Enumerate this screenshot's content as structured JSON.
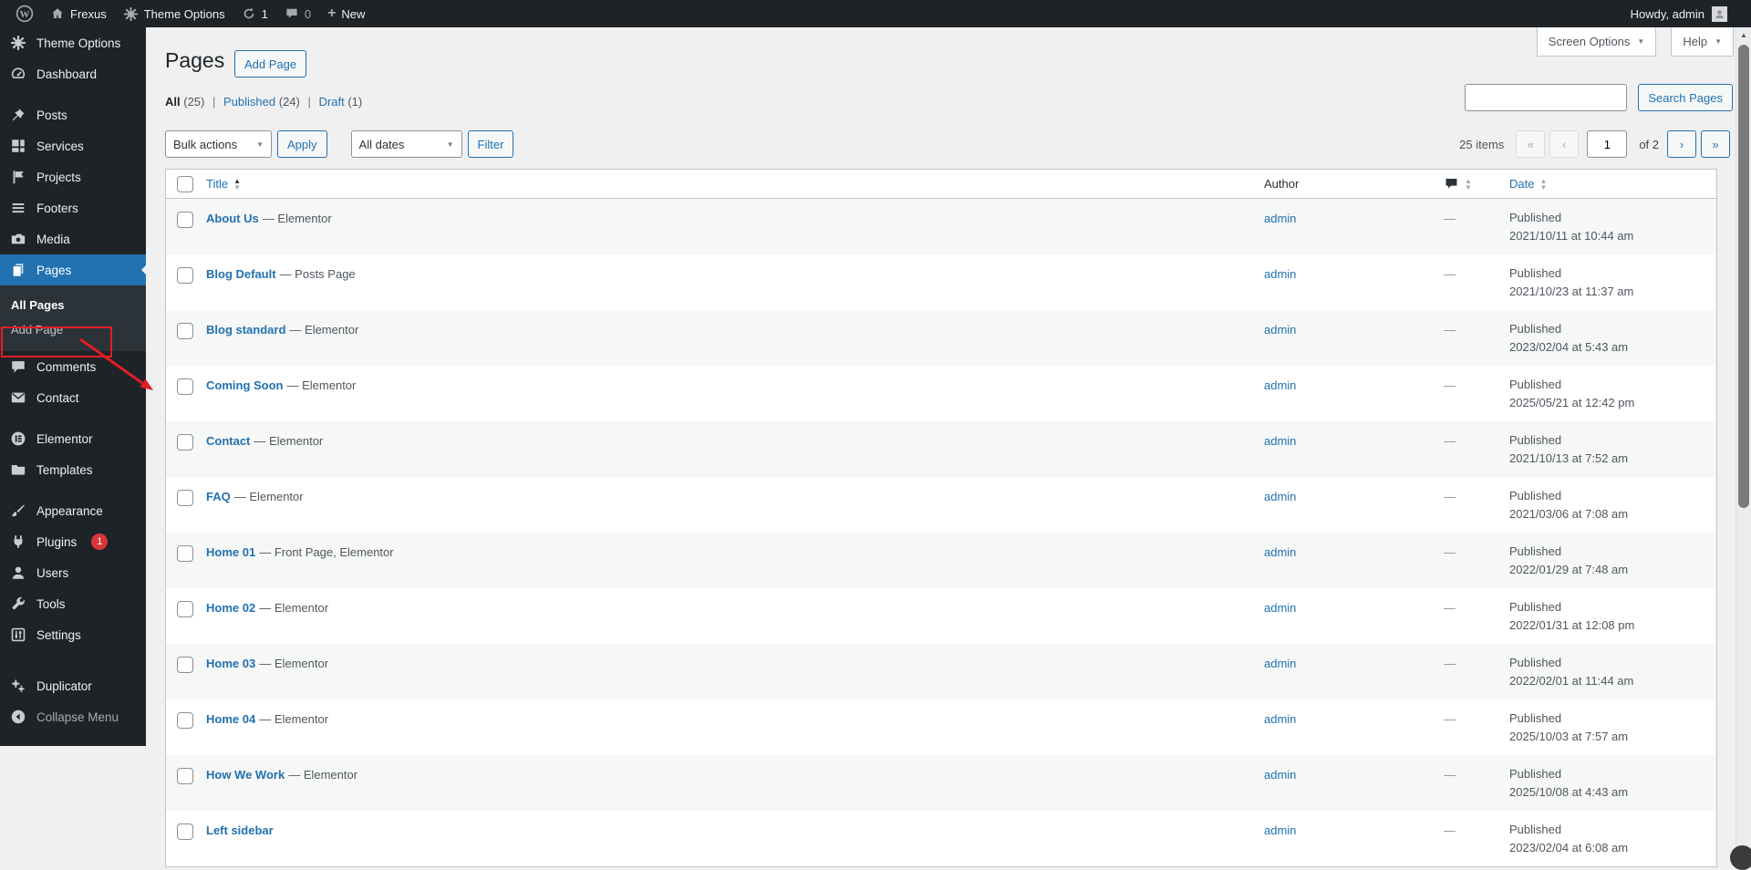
{
  "colors": {
    "accent": "#2271b1",
    "menu_dark": "#1d2327",
    "badge_red": "#d63638",
    "annotation_red": "#e11e26",
    "stripe": "#f6f7f7"
  },
  "admin_bar": {
    "site_name": "Frexus",
    "theme_options": "Theme Options",
    "update_count": "1",
    "comment_count": "0",
    "new_label": "New",
    "greeting": "Howdy, admin"
  },
  "sidebar": {
    "items": [
      {
        "label": "Theme Options"
      },
      {
        "label": "Dashboard"
      },
      {
        "label": "Posts"
      },
      {
        "label": "Services"
      },
      {
        "label": "Projects"
      },
      {
        "label": "Footers"
      },
      {
        "label": "Media"
      },
      {
        "label": "Pages",
        "active": true
      },
      {
        "label": "Comments"
      },
      {
        "label": "Contact"
      },
      {
        "label": "Elementor"
      },
      {
        "label": "Templates"
      },
      {
        "label": "Appearance"
      },
      {
        "label": "Plugins"
      },
      {
        "label": "Users"
      },
      {
        "label": "Tools"
      },
      {
        "label": "Settings"
      },
      {
        "label": "Duplicator"
      },
      {
        "label": "Collapse Menu"
      }
    ],
    "plugins_badge": "1",
    "submenu": {
      "all_pages": "All Pages",
      "add_page": "Add Page"
    }
  },
  "meta_tabs": {
    "screen_options": "Screen Options",
    "help": "Help"
  },
  "page": {
    "title": "Pages",
    "add_button": "Add Page"
  },
  "views": {
    "all": "All",
    "all_count": "(25)",
    "published": "Published",
    "published_count": "(24)",
    "draft": "Draft",
    "draft_count": "(1)",
    "separator": "|"
  },
  "toolbar": {
    "bulk_actions": "Bulk actions",
    "apply": "Apply",
    "all_dates": "All dates",
    "filter": "Filter"
  },
  "search": {
    "value": "",
    "button": "Search Pages"
  },
  "pagination": {
    "items": "25 items",
    "first": "«",
    "prev": "‹",
    "current_page": "1",
    "of": "of 2",
    "next": "›",
    "last": "»"
  },
  "table": {
    "columns": {
      "title": "Title",
      "author": "Author",
      "date": "Date"
    },
    "rows": [
      {
        "title": "About Us",
        "suffix": "— Elementor",
        "author": "admin",
        "comments": "—",
        "status": "Published",
        "date": "2021/10/11 at 10:44 am"
      },
      {
        "title": "Blog Default",
        "suffix": "— Posts Page",
        "author": "admin",
        "comments": "—",
        "status": "Published",
        "date": "2021/10/23 at 11:37 am"
      },
      {
        "title": "Blog standard",
        "suffix": "— Elementor",
        "author": "admin",
        "comments": "—",
        "status": "Published",
        "date": "2023/02/04 at 5:43 am"
      },
      {
        "title": "Coming Soon",
        "suffix": "— Elementor",
        "author": "admin",
        "comments": "—",
        "status": "Published",
        "date": "2025/05/21 at 12:42 pm"
      },
      {
        "title": "Contact",
        "suffix": "— Elementor",
        "author": "admin",
        "comments": "—",
        "status": "Published",
        "date": "2021/10/13 at 7:52 am"
      },
      {
        "title": "FAQ",
        "suffix": "— Elementor",
        "author": "admin",
        "comments": "—",
        "status": "Published",
        "date": "2021/03/06 at 7:08 am"
      },
      {
        "title": "Home 01",
        "suffix": "— Front Page, Elementor",
        "author": "admin",
        "comments": "—",
        "status": "Published",
        "date": "2022/01/29 at 7:48 am"
      },
      {
        "title": "Home 02",
        "suffix": "— Elementor",
        "author": "admin",
        "comments": "—",
        "status": "Published",
        "date": "2022/01/31 at 12:08 pm"
      },
      {
        "title": "Home 03",
        "suffix": "— Elementor",
        "author": "admin",
        "comments": "—",
        "status": "Published",
        "date": "2022/02/01 at 11:44 am"
      },
      {
        "title": "Home 04",
        "suffix": "— Elementor",
        "author": "admin",
        "comments": "—",
        "status": "Published",
        "date": "2025/10/03 at 7:57 am"
      },
      {
        "title": "How We Work",
        "suffix": "— Elementor",
        "author": "admin",
        "comments": "—",
        "status": "Published",
        "date": "2025/10/08 at 4:43 am"
      },
      {
        "title": "Left sidebar",
        "suffix": "",
        "author": "admin",
        "comments": "—",
        "status": "Published",
        "date": "2023/02/04 at 6:08 am"
      }
    ]
  }
}
